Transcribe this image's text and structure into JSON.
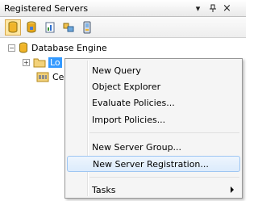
{
  "window": {
    "title": "Registered Servers",
    "pin_glyph": "¶",
    "close_glyph": "×",
    "menu_glyph": "▾"
  },
  "toolbar": {
    "buttons": [
      {
        "icon": "database-engine-icon",
        "active": true
      },
      {
        "icon": "analysis-services-icon",
        "active": false
      },
      {
        "icon": "reporting-services-icon",
        "active": false
      },
      {
        "icon": "integration-services-icon",
        "active": false
      },
      {
        "icon": "sql-compact-icon",
        "active": false
      }
    ]
  },
  "tree": {
    "root": {
      "label": "Database Engine",
      "expander": "−"
    },
    "children": [
      {
        "label": "Lo",
        "expander": "+",
        "selected": true
      },
      {
        "label": "Ce",
        "expander": null,
        "selected": false
      }
    ]
  },
  "context_menu": {
    "items": [
      {
        "label": "New Query"
      },
      {
        "label": "Object Explorer"
      },
      {
        "label": "Evaluate Policies..."
      },
      {
        "label": "Import Policies..."
      },
      {
        "label": "New Server Group..."
      },
      {
        "label": "New Server Registration...",
        "hover": true
      },
      {
        "label": "Tasks",
        "submenu": true
      }
    ]
  },
  "colors": {
    "selection": "#3399ff",
    "menu_hover_border": "#9ec6f2",
    "toolbar_active": "#ffe7a2"
  }
}
